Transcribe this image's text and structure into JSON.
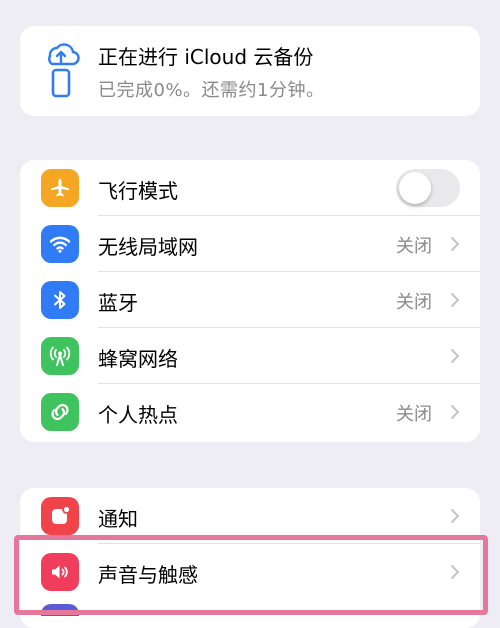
{
  "backup": {
    "title": "正在进行 iCloud 云备份",
    "subtitle": "已完成0%。还需约1分钟。"
  },
  "network_section": {
    "items": [
      {
        "label": "飞行模式",
        "icon": "airplane-icon",
        "icon_color": "#f5a623",
        "toggle_on": false
      },
      {
        "label": "无线局域网",
        "value": "关闭",
        "icon": "wifi-icon",
        "icon_color": "#2f7cf6"
      },
      {
        "label": "蓝牙",
        "value": "关闭",
        "icon": "bluetooth-icon",
        "icon_color": "#2f7cf6"
      },
      {
        "label": "蜂窝网络",
        "value": "",
        "icon": "cellular-icon",
        "icon_color": "#3fc35f"
      },
      {
        "label": "个人热点",
        "value": "关闭",
        "icon": "hotspot-icon",
        "icon_color": "#3fc35f"
      }
    ]
  },
  "notify_section": {
    "items": [
      {
        "label": "通知",
        "icon": "notification-icon",
        "icon_color": "#f0444a"
      },
      {
        "label": "声音与触感",
        "icon": "speaker-icon",
        "icon_color": "#ef3d5b"
      }
    ]
  },
  "colors": {
    "background": "#efedf4",
    "highlight": "#e4779b",
    "secondary_text": "#8a8a8e"
  }
}
